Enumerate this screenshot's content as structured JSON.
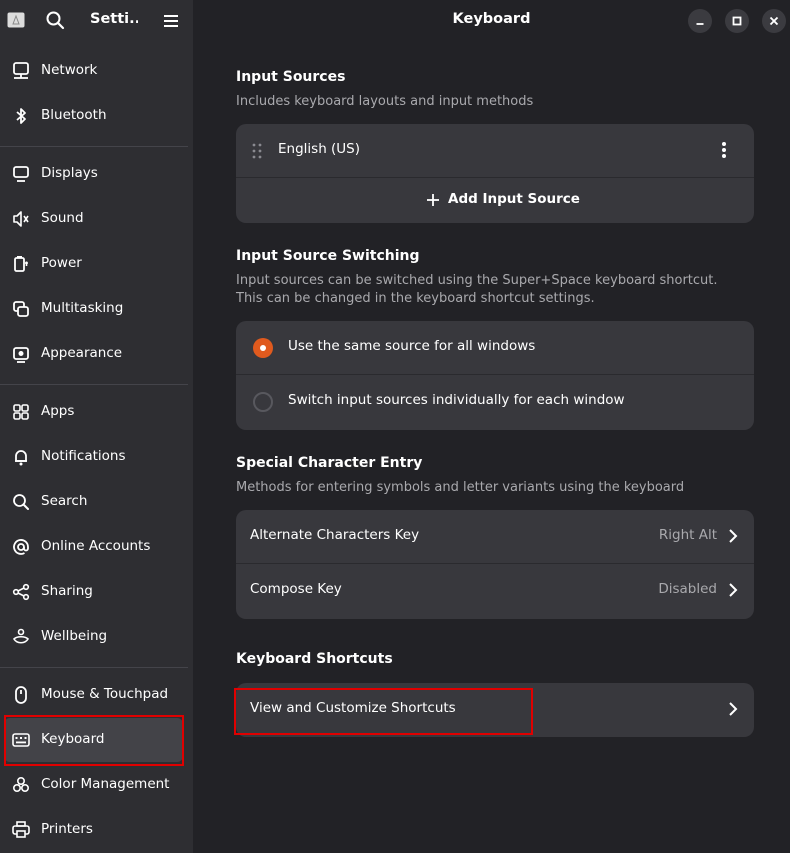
{
  "sidebar": {
    "title": "Setti...",
    "items": [
      {
        "label": "Network",
        "icon": "network-icon"
      },
      {
        "label": "Bluetooth",
        "icon": "bluetooth-icon"
      },
      {
        "label": "Displays",
        "icon": "display-icon"
      },
      {
        "label": "Sound",
        "icon": "sound-icon"
      },
      {
        "label": "Power",
        "icon": "power-icon"
      },
      {
        "label": "Multitasking",
        "icon": "multitasking-icon"
      },
      {
        "label": "Appearance",
        "icon": "appearance-icon"
      },
      {
        "label": "Apps",
        "icon": "apps-icon"
      },
      {
        "label": "Notifications",
        "icon": "bell-icon"
      },
      {
        "label": "Search",
        "icon": "search-icon"
      },
      {
        "label": "Online Accounts",
        "icon": "at-icon"
      },
      {
        "label": "Sharing",
        "icon": "share-icon"
      },
      {
        "label": "Wellbeing",
        "icon": "wellbeing-icon"
      },
      {
        "label": "Mouse & Touchpad",
        "icon": "mouse-icon"
      },
      {
        "label": "Keyboard",
        "icon": "keyboard-icon",
        "active": true
      },
      {
        "label": "Color Management",
        "icon": "color-icon"
      },
      {
        "label": "Printers",
        "icon": "printer-icon"
      }
    ]
  },
  "main": {
    "title": "Keyboard",
    "input_sources": {
      "title": "Input Sources",
      "subtitle": "Includes keyboard layouts and input methods",
      "source": "English (US)",
      "add_label": "Add Input Source"
    },
    "switching": {
      "title": "Input Source Switching",
      "subtitle_line1": "Input sources can be switched using the Super+Space keyboard shortcut.",
      "subtitle_line2": "This can be changed in the keyboard shortcut settings.",
      "option_same": "Use the same source for all windows",
      "option_individual": "Switch input sources individually for each window",
      "selected": "same"
    },
    "special": {
      "title": "Special Character Entry",
      "subtitle": "Methods for entering symbols and letter variants using the keyboard",
      "alt_label": "Alternate Characters Key",
      "alt_value": "Right Alt",
      "compose_label": "Compose Key",
      "compose_value": "Disabled"
    },
    "shortcuts": {
      "title": "Keyboard Shortcuts",
      "view_label": "View and Customize Shortcuts"
    }
  },
  "colors": {
    "accent": "#e05a1e",
    "highlight": "#e00000",
    "sidebar_bg": "#2e2e32",
    "main_bg": "#222226",
    "card_bg": "#38383d"
  }
}
